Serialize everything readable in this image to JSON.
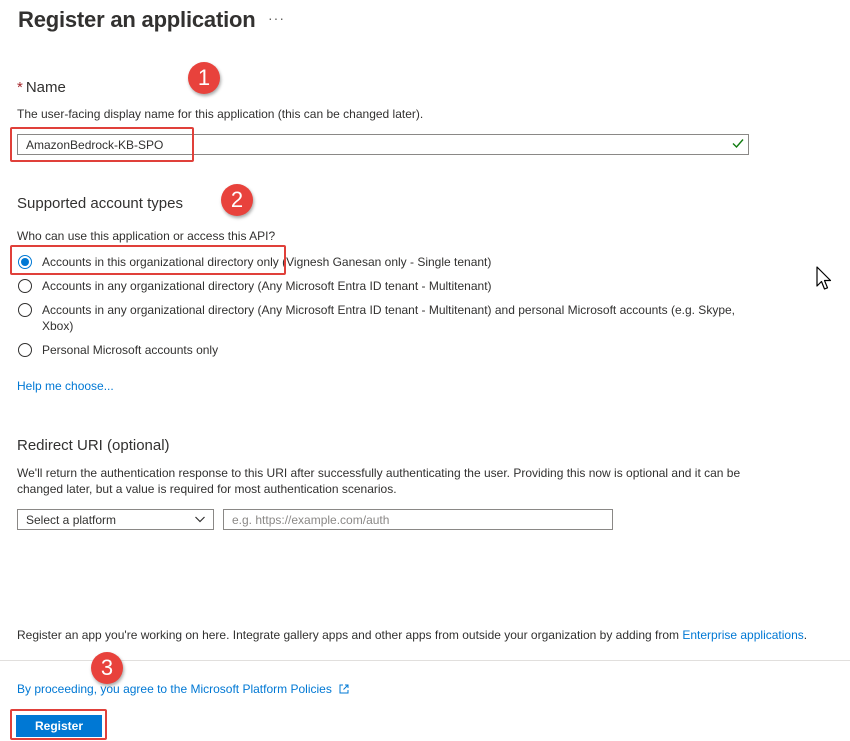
{
  "header": {
    "title": "Register an application",
    "more_label": "···"
  },
  "name_section": {
    "required_mark": "*",
    "label": "Name",
    "description": "The user-facing display name for this application (this can be changed later).",
    "value": "AmazonBedrock-KB-SPO"
  },
  "account_types": {
    "heading": "Supported account types",
    "question": "Who can use this application or access this API?",
    "options": [
      {
        "label": "Accounts in this organizational directory only (Vignesh Ganesan only - Single tenant)",
        "checked": true
      },
      {
        "label": "Accounts in any organizational directory (Any Microsoft Entra ID tenant - Multitenant)",
        "checked": false
      },
      {
        "label": "Accounts in any organizational directory (Any Microsoft Entra ID tenant - Multitenant) and personal Microsoft accounts (e.g. Skype, Xbox)",
        "checked": false
      },
      {
        "label": "Personal Microsoft accounts only",
        "checked": false
      }
    ],
    "help_link": "Help me choose..."
  },
  "redirect": {
    "heading": "Redirect URI (optional)",
    "description": "We'll return the authentication response to this URI after successfully authenticating the user. Providing this now is optional and it can be changed later, but a value is required for most authentication scenarios.",
    "platform_selected": "Select a platform",
    "uri_placeholder": "e.g. https://example.com/auth",
    "uri_value": ""
  },
  "footer": {
    "info_text": "Register an app you're working on here. Integrate gallery apps and other apps from outside your organization by adding from",
    "enterprise_link": "Enterprise applications",
    "info_end": ".",
    "policy_link": "By proceeding, you agree to the Microsoft Platform Policies",
    "register_label": "Register"
  },
  "annotations": {
    "marker_1": "1",
    "marker_2": "2",
    "marker_3": "3",
    "color": "#e8423c"
  },
  "colors": {
    "accent": "#0078d4",
    "required": "#a4262c",
    "success": "#107c10"
  }
}
